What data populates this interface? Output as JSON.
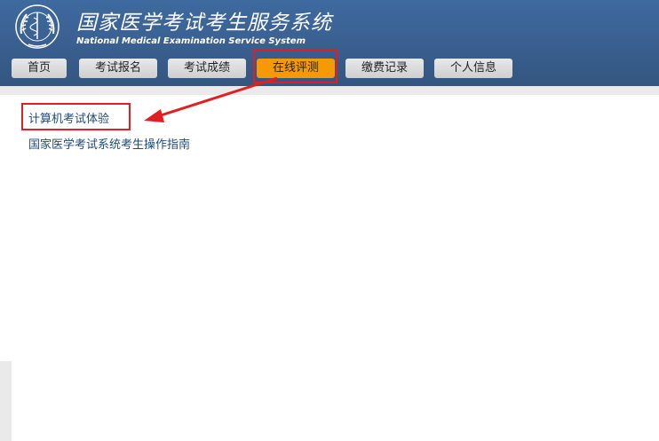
{
  "header": {
    "title_cn": "国家医学考试考生服务系统",
    "title_en": "National Medical Examination Service System"
  },
  "nav": {
    "items": [
      {
        "label": "首页"
      },
      {
        "label": "考试报名"
      },
      {
        "label": "考试成绩"
      },
      {
        "label": "在线评测",
        "active": true
      },
      {
        "label": "缴费记录"
      },
      {
        "label": "个人信息"
      }
    ]
  },
  "content": {
    "links": [
      {
        "label": "计算机考试体验"
      },
      {
        "label": "国家医学考试系统考生操作指南"
      }
    ]
  },
  "colors": {
    "header_blue": "#3e6aa0",
    "active_tab": "#f59a05",
    "annotation_red": "#e02020",
    "link_blue": "#1e4b7a"
  }
}
